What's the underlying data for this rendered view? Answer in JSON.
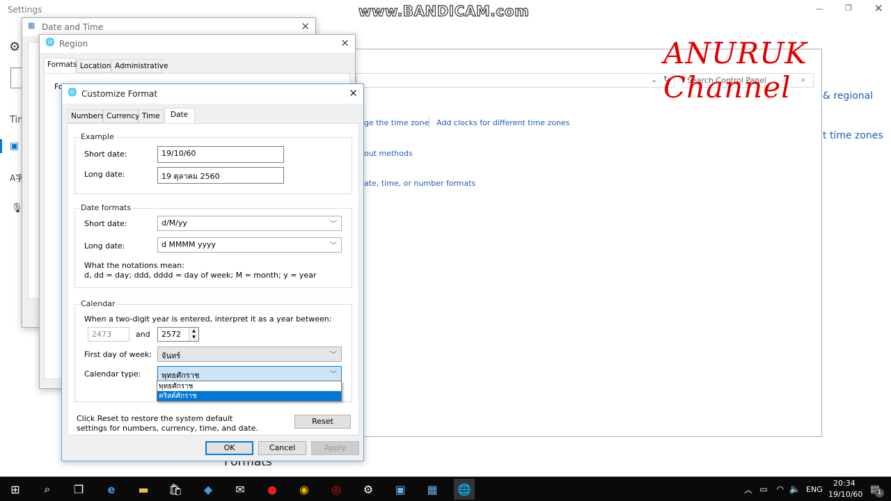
{
  "watermark": "www.BANDICAM.com",
  "channel_logo": "ANURUK Channel",
  "settings": {
    "title": "Settings",
    "partial_label": "Tim",
    "heading_formats": "Formats",
    "right_link1": "& regional",
    "right_link2": "t time zones"
  },
  "control_panel": {
    "search_placeholder": "Search Control Panel",
    "links": [
      "ge the time zone",
      "Add clocks for different time zones",
      "out methods",
      "ate, time, or number formats"
    ]
  },
  "date_time_window": {
    "title": "Date and Time"
  },
  "region_window": {
    "title": "Region",
    "tabs": [
      "Formats",
      "Location",
      "Administrative"
    ],
    "partial": "Fo"
  },
  "customize": {
    "title": "Customize Format",
    "tabs": [
      "Numbers",
      "Currency",
      "Time",
      "Date"
    ],
    "active_tab": "Date",
    "example": {
      "label": "Example",
      "short_label": "Short date:",
      "short_value": "19/10/60",
      "long_label": "Long date:",
      "long_value": "19 ตุลาคม 2560"
    },
    "formats": {
      "label": "Date formats",
      "short_label": "Short date:",
      "short_value": "d/M/yy",
      "long_label": "Long date:",
      "long_value": "d MMMM yyyy",
      "notation_title": "What the notations mean:",
      "notation_text": "d, dd = day;  ddd, dddd = day of week;  M = month;  y = year"
    },
    "calendar": {
      "label": "Calendar",
      "two_digit_text": "When a two-digit year is entered, interpret it as a year between:",
      "from_year": "2473",
      "and": "and",
      "to_year": "2572",
      "first_day_label": "First day of week:",
      "first_day_value": "จันทร์",
      "type_label": "Calendar type:",
      "type_value": "พุทธศักราช",
      "type_options": [
        "พุทธศักราช",
        "คริสต์ศักราช"
      ],
      "highlighted_option": "คริสต์ศักราช"
    },
    "reset_text": "Click Reset to restore the system default settings for numbers, currency, time, and date.",
    "reset": "Reset",
    "ok": "OK",
    "cancel": "Cancel",
    "apply": "Apply"
  },
  "taskbar": {
    "lang": "ENG",
    "time": "20:34",
    "date": "19/10/60",
    "notifications": "1"
  },
  "colors": {
    "accent": "#0078d7",
    "link": "#1a5fb4",
    "taskbar": "#0a0a0a",
    "logo_red": "#e00000"
  }
}
